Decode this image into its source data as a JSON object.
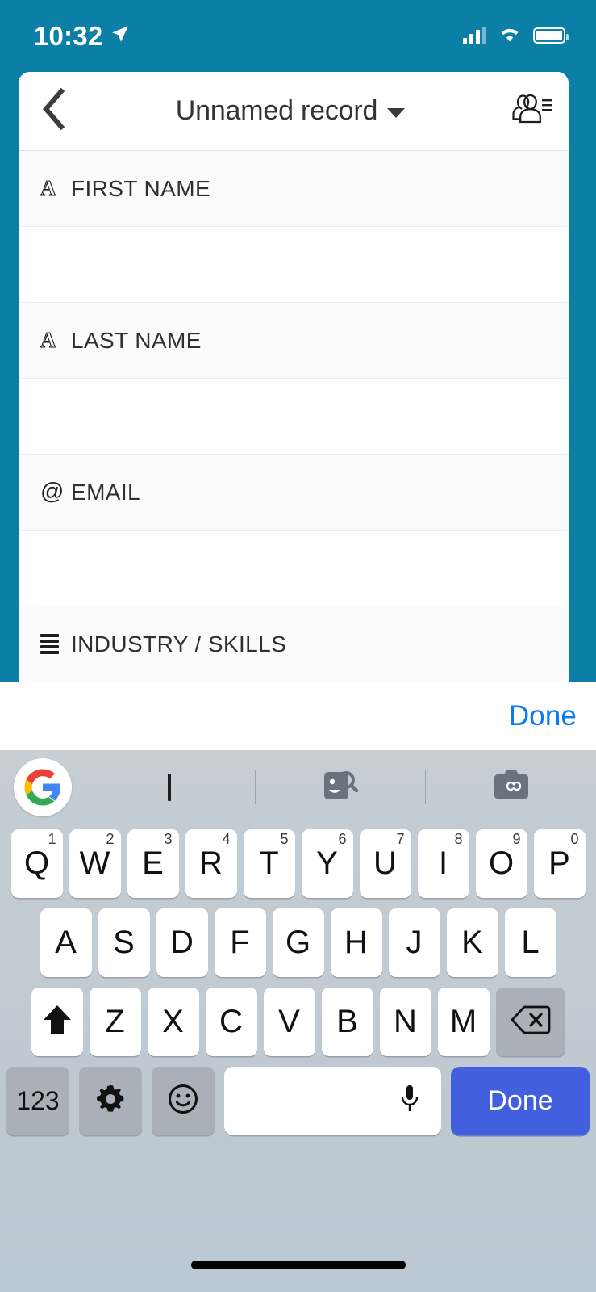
{
  "status_bar": {
    "time": "10:32",
    "location_icon": "location-arrow-icon",
    "signal_icon": "cellular-signal-icon",
    "wifi_icon": "wifi-icon",
    "battery_icon": "battery-full-icon"
  },
  "nav": {
    "back_icon": "chevron-left-icon",
    "title": "Unnamed record",
    "dropdown_icon": "chevron-down-icon",
    "contacts_icon": "contacts-list-icon"
  },
  "fields": [
    {
      "label": "FIRST NAME",
      "icon": "text-field-icon",
      "icon_glyph": "A",
      "value": ""
    },
    {
      "label": "LAST NAME",
      "icon": "text-field-icon",
      "icon_glyph": "A",
      "value": ""
    },
    {
      "label": "EMAIL",
      "icon": "email-field-icon",
      "icon_glyph": "@",
      "value": ""
    },
    {
      "label": "INDUSTRY / SKILLS",
      "icon": "list-field-icon",
      "icon_glyph": "☰",
      "value": ""
    }
  ],
  "accessory_bar": {
    "done_label": "Done"
  },
  "keyboard": {
    "toolbar": {
      "google_logo": "google-g-logo-icon",
      "cursor_icon": "text-cursor-icon",
      "sticker_search_icon": "sticker-search-icon",
      "lens_icon": "google-lens-camera-icon"
    },
    "row1": [
      {
        "letter": "Q",
        "num": "1"
      },
      {
        "letter": "W",
        "num": "2"
      },
      {
        "letter": "E",
        "num": "3"
      },
      {
        "letter": "R",
        "num": "4"
      },
      {
        "letter": "T",
        "num": "5"
      },
      {
        "letter": "Y",
        "num": "6"
      },
      {
        "letter": "U",
        "num": "7"
      },
      {
        "letter": "I",
        "num": "8"
      },
      {
        "letter": "O",
        "num": "9"
      },
      {
        "letter": "P",
        "num": "0"
      }
    ],
    "row2": [
      {
        "letter": "A"
      },
      {
        "letter": "S"
      },
      {
        "letter": "D"
      },
      {
        "letter": "F"
      },
      {
        "letter": "G"
      },
      {
        "letter": "H"
      },
      {
        "letter": "J"
      },
      {
        "letter": "K"
      },
      {
        "letter": "L"
      }
    ],
    "row3": [
      {
        "letter": "Z"
      },
      {
        "letter": "X"
      },
      {
        "letter": "C"
      },
      {
        "letter": "V"
      },
      {
        "letter": "B"
      },
      {
        "letter": "N"
      },
      {
        "letter": "M"
      }
    ],
    "shift_icon": "shift-arrow-icon",
    "backspace_icon": "backspace-delete-icon",
    "numbers_key_label": "123",
    "settings_icon": "gear-icon",
    "emoji_icon": "emoji-smiley-icon",
    "mic_icon": "microphone-icon",
    "space_label": "",
    "enter_label": "Done"
  },
  "home_indicator": "home-indicator-bar",
  "colors": {
    "app_teal": "#0b7fa5",
    "done_blue": "#0a7cf0",
    "enter_blue": "#4260dd",
    "keyboard_bg": "#c4ccd3",
    "key_white": "#ffffff",
    "key_grey": "#a9b0b8"
  }
}
